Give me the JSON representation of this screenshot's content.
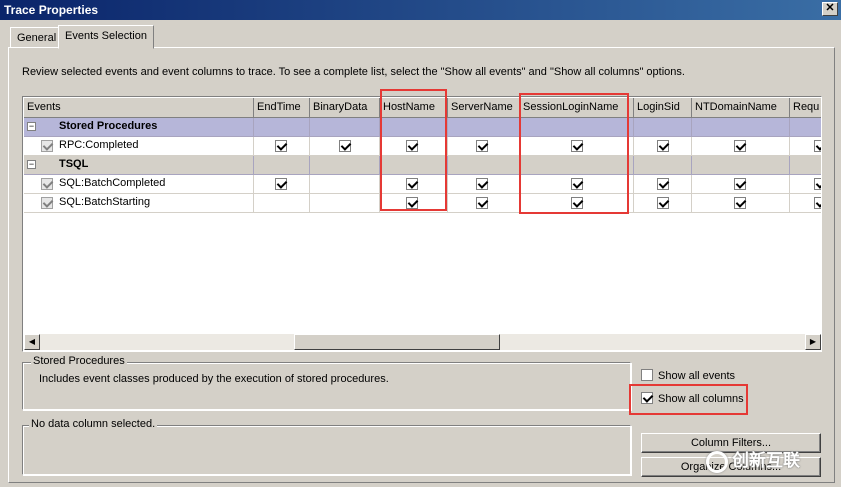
{
  "window": {
    "title": "Trace Properties",
    "close_glyph": "✕"
  },
  "tabs": [
    {
      "label": "General",
      "active": false
    },
    {
      "label": "Events Selection",
      "active": true
    }
  ],
  "description": "Review selected events and event columns to trace. To see a complete list, select the \"Show all events\" and \"Show all columns\" options.",
  "grid": {
    "columns": [
      "Events",
      "EndTime",
      "BinaryData",
      "HostName",
      "ServerName",
      "SessionLoginName",
      "LoginSid",
      "NTDomainName",
      "Requ"
    ],
    "groups": [
      {
        "name": "Stored Procedures",
        "expander": "−",
        "selected": true,
        "events": [
          {
            "name": "RPC:Completed",
            "checked": [
              true,
              true,
              true,
              true,
              true,
              true,
              true,
              true
            ]
          }
        ]
      },
      {
        "name": "TSQL",
        "expander": "−",
        "selected": false,
        "events": [
          {
            "name": "SQL:BatchCompleted",
            "checked": [
              true,
              false,
              true,
              true,
              true,
              true,
              true,
              true
            ]
          },
          {
            "name": "SQL:BatchStarting",
            "checked": [
              false,
              false,
              true,
              true,
              true,
              true,
              true,
              true
            ]
          }
        ]
      }
    ],
    "scroll_left": "◀",
    "scroll_right": "▶"
  },
  "event_info": {
    "title": "Stored Procedures",
    "text": "Includes event classes produced by the execution of stored procedures."
  },
  "column_info": {
    "text": "No data column selected."
  },
  "options": {
    "show_all_events": {
      "label": "Show all events",
      "checked": false
    },
    "show_all_columns": {
      "label": "Show all columns",
      "checked": true
    }
  },
  "buttons": {
    "column_filters": "Column Filters...",
    "organize_columns": "Organize Columns..."
  },
  "watermark": "创新互联",
  "colors": {
    "highlight": "#e53935",
    "title_bar": "#0a246a",
    "selected_group": "#b6b6d9"
  }
}
